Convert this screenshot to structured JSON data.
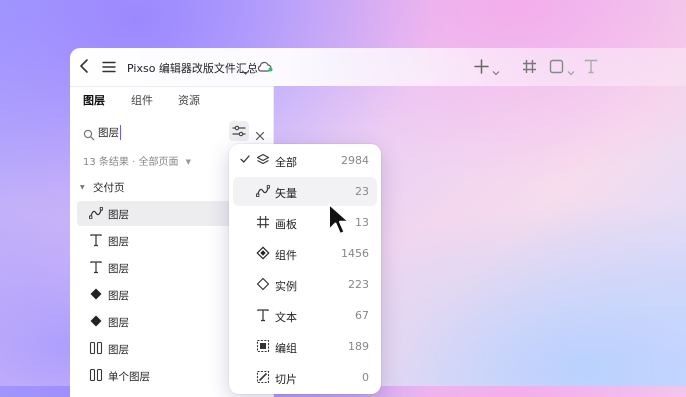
{
  "header": {
    "file_title": "Pixso 编辑器改版文件汇总",
    "icons": [
      "back-icon",
      "menu-icon",
      "chevron-down-icon",
      "cloud-sync-icon",
      "plus-icon",
      "frame-icon",
      "shape-icon",
      "text-tool-icon"
    ]
  },
  "tabs": [
    {
      "label": "图层",
      "active": true
    },
    {
      "label": "组件",
      "active": false
    },
    {
      "label": "资源",
      "active": false
    }
  ],
  "search": {
    "value": "图层",
    "icons": [
      "search-icon",
      "filter-icon",
      "close-icon"
    ]
  },
  "results": {
    "text": "13 条结果 · 全部页面"
  },
  "section": {
    "label": "交付页"
  },
  "layers": [
    {
      "label": "图层",
      "icon": "vector-icon",
      "selected": true
    },
    {
      "label": "图层",
      "icon": "text-icon"
    },
    {
      "label": "图层",
      "icon": "text-icon"
    },
    {
      "label": "图层",
      "icon": "component-icon"
    },
    {
      "label": "图层",
      "icon": "component-icon"
    },
    {
      "label": "图层",
      "icon": "columns-icon"
    },
    {
      "label": "单个图层",
      "icon": "columns-icon"
    }
  ],
  "filter_menu": {
    "items": [
      {
        "label": "全部",
        "count": "2984",
        "icon": "layers-icon",
        "checked": true
      },
      {
        "label": "矢量",
        "count": "23",
        "icon": "vector-icon",
        "hovered": true
      },
      {
        "label": "画板",
        "count": "13",
        "icon": "frame-icon"
      },
      {
        "label": "组件",
        "count": "1456",
        "icon": "component-icon"
      },
      {
        "label": "实例",
        "count": "223",
        "icon": "instance-icon"
      },
      {
        "label": "文本",
        "count": "67",
        "icon": "text-icon"
      },
      {
        "label": "编组",
        "count": "189",
        "icon": "group-icon"
      },
      {
        "label": "切片",
        "count": "0",
        "icon": "slice-icon"
      }
    ]
  },
  "colors": {
    "accent": "#6b5cff",
    "cloud_status": "#29c46a",
    "hover_row": "#f2f2f5"
  }
}
